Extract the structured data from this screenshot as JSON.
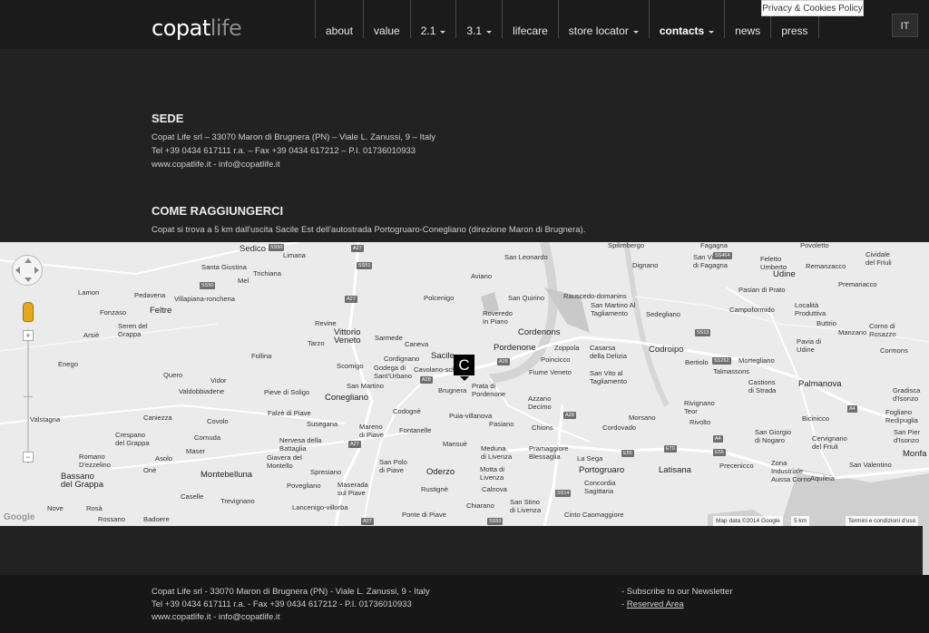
{
  "header": {
    "logo_main": "copat",
    "logo_light": "life",
    "nav": [
      {
        "label": "about",
        "dropdown": false,
        "active": false
      },
      {
        "label": "value",
        "dropdown": false,
        "active": false
      },
      {
        "label": "2.1",
        "dropdown": true,
        "active": false
      },
      {
        "label": "3.1",
        "dropdown": true,
        "active": false
      },
      {
        "label": "lifecare",
        "dropdown": false,
        "active": false
      },
      {
        "label": "store locator",
        "dropdown": true,
        "active": false
      },
      {
        "label": "contacts",
        "dropdown": true,
        "active": true
      },
      {
        "label": "news",
        "dropdown": false,
        "active": false
      },
      {
        "label": "press",
        "dropdown": false,
        "active": false
      }
    ],
    "privacy_link": "Privacy & Cookies Policy",
    "language": "IT"
  },
  "sede": {
    "title": "SEDE",
    "line1": "Copat Life srl – 33070 Maron di Brugnera (PN) – Viale L. Zanussi, 9 – Italy",
    "line2": "Tel +39 0434 617111 r.a. – Fax +39 0434 617212 – P.I. 01736010933",
    "line3": "www.copatlife.it - info@copatlife.it"
  },
  "directions": {
    "title": "COME RAGGIUNGERCI",
    "text": "Copat si trova a 5 km dall'uscita Sacile Est dell'autostrada Portogruaro-Conegliano (direzione Maron di Brugnera)."
  },
  "map": {
    "marker_label": "C",
    "attribution": "Map data ©2014 Google",
    "scale": "5 km",
    "terms": "Termini e condizioni d'uso",
    "google_logo": "Google",
    "places": [
      "Sedico",
      "Limana",
      "Spilimbergo",
      "Fagagna",
      "Povoletto",
      "Cividale del Friuli",
      "Santa Giustina",
      "Trichiana",
      "San Leonardo",
      "Dignano",
      "San Vito di Fagagna",
      "Feletto Umberto",
      "Remanzacco",
      "Mel",
      "Aviano",
      "Udine",
      "Premariacco",
      "Lamon",
      "Pedavena",
      "Villapiana-ronchena",
      "Polcenigo",
      "San Quirino",
      "Rauscedo-domanins",
      "Pasian di Prato",
      "Fonzaso",
      "Feltre",
      "Roveredo In Piano",
      "San Martino Al Tagliamento",
      "Sedegliano",
      "Campoformido",
      "Località Produttiva",
      "Seren del Grappa",
      "Revine",
      "Vittorio Veneto",
      "Cordenons",
      "Buttrio",
      "Arsiè",
      "Tarzo",
      "Sarmede",
      "Caneva",
      "Pordenone",
      "Zoppola",
      "Casarsa della Delizia",
      "Codroipo",
      "Pavia di Udine",
      "Manzano",
      "Corno di Rosazzo",
      "Follina",
      "Cordignano",
      "Sacile",
      "Poincicco",
      "Mortegliano",
      "Cormons",
      "Enego",
      "Scomigo",
      "Godega di Sant'Urbano",
      "Cavolano-schiavoi",
      "Fiume Veneto",
      "Bertiolo",
      "Talmassons",
      "Quero",
      "Vidor",
      "San Martino",
      "Brugnera",
      "Prata di Pordenone",
      "San Vito al Tagliamento",
      "Castions di Strada",
      "Palmanova",
      "Valdobbiadene",
      "Pieve di Soligo",
      "Conegliano",
      "Azzano Decimo",
      "Rivignano Teor",
      "Gradisca d'Isonzo",
      "Valstagna",
      "Caniezza",
      "Covolo",
      "Falzè di Piave",
      "Codognè",
      "Puia-villanova",
      "Morsano",
      "Bicinicco",
      "Crespano del Grappa",
      "Cornuda",
      "Susegana",
      "Mareno di Piave",
      "Fontanelle",
      "Pasiano",
      "Chions",
      "Cordovado",
      "Rivolto",
      "Fogliano Redipuglia",
      "Nervesa della Battaglia",
      "Mansuè",
      "Meduna di Livenza",
      "Pramaggiore Blessaglia",
      "San Giorgio di Nogaro",
      "Cervignano del Friuli",
      "San Pier d'Isonzo",
      "Romano D'ezzelino",
      "Asolo",
      "Maser",
      "Giavera del Montello",
      "Spresiano",
      "San Polo di Piave",
      "Motta di Livenza",
      "La Sega",
      "Portogruaro",
      "Latisana",
      "Precenicco",
      "Zona Industriale Aussa Corno",
      "San Valentino",
      "Monfalcone",
      "Onè",
      "Montebelluna",
      "Povegliano",
      "Maserada sul Piave",
      "Oderzo",
      "Rustignè",
      "Calnova",
      "Concordia Sagittaria",
      "Aquileia",
      "Bassano del Grappa",
      "Caselle",
      "Trevignano",
      "Chiarano",
      "San Stino di Livenza",
      "Nove",
      "Rosà",
      "Rossano",
      "Badoere",
      "Lancenigo-villorba",
      "Ponte di Piave",
      "Cinto Caomaggiore"
    ]
  },
  "footer": {
    "line1": "Copat Life srl - 33070 Maron di Brugnera (PN) - Viale L. Zanussi, 9 - Italy",
    "line2": "Tel +39 0434 617111 r.a. - Fax +39 0434 617212 - P.I. 01736010933",
    "line3": "www.copatlife.it - info@copatlife.it",
    "newsletter": "- Subscribe to our Newsletter",
    "reserved_prefix": "- ",
    "reserved": "Reserved Area"
  }
}
